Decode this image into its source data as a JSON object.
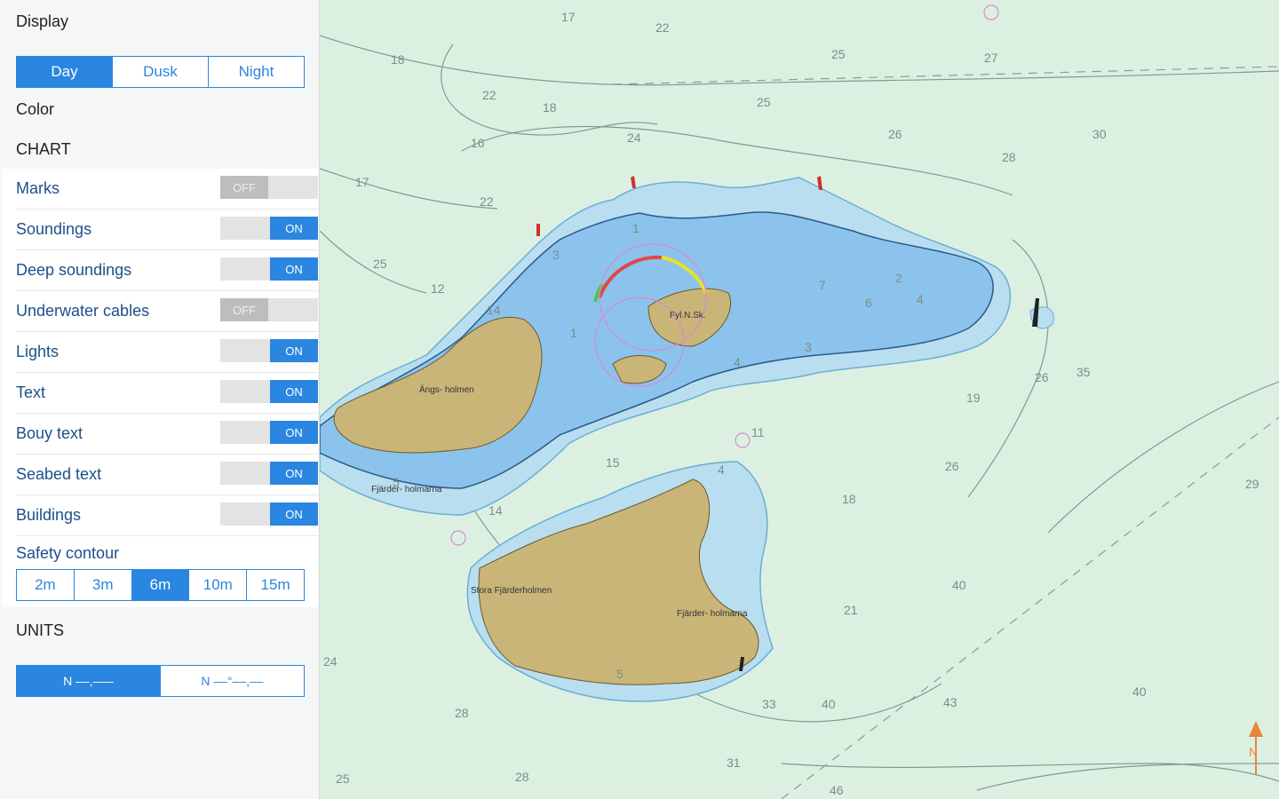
{
  "panel": {
    "display_label": "Display",
    "modes": [
      "Day",
      "Dusk",
      "Night"
    ],
    "color_label": "Color",
    "chart_label": "CHART",
    "toggles": [
      {
        "label": "Marks",
        "state": "OFF"
      },
      {
        "label": "Soundings",
        "state": "ON"
      },
      {
        "label": "Deep soundings",
        "state": "ON"
      },
      {
        "label": "Underwater cables",
        "state": "OFF"
      },
      {
        "label": "Lights",
        "state": "ON"
      },
      {
        "label": "Text",
        "state": "ON"
      },
      {
        "label": "Bouy text",
        "state": "ON"
      },
      {
        "label": "Seabed text",
        "state": "ON"
      },
      {
        "label": "Buildings",
        "state": "ON"
      }
    ],
    "safety_contour_label": "Safety contour",
    "safety_options": [
      "2m",
      "3m",
      "6m",
      "10m",
      "15m"
    ],
    "units_label": "UNITS",
    "unit_options": [
      "N ––,–––",
      "N ––°––,––"
    ]
  },
  "map": {
    "north_label": "N",
    "depths": [
      "17",
      "22",
      "25",
      "27",
      "18",
      "22",
      "18",
      "25",
      "16",
      "24",
      "26",
      "30",
      "28",
      "17",
      "22",
      "25",
      "12",
      "26",
      "35",
      "19",
      "15",
      "18",
      "14",
      "11",
      "26",
      "29",
      "40",
      "43",
      "40",
      "21",
      "33",
      "40",
      "24",
      "28",
      "25",
      "28",
      "31",
      "46",
      "3",
      "1",
      "7",
      "6",
      "4",
      "3",
      "1",
      "14",
      "2",
      "4",
      "5",
      "5",
      "4"
    ],
    "place_names": [
      "Ängs- holmen",
      "Fyl.N.Sk.",
      "Fjärder- holmarna",
      "Stora Fjärderholmen",
      "Fjärder- holmarna"
    ]
  }
}
